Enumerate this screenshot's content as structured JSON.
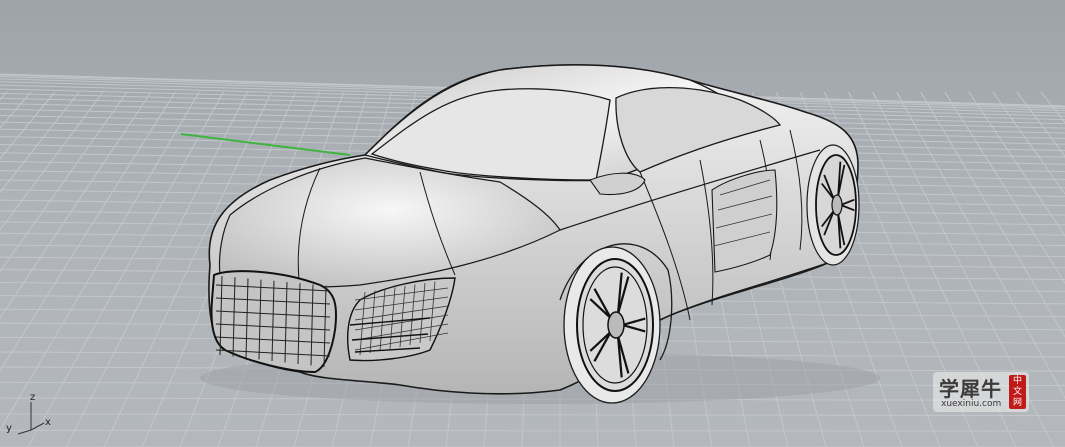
{
  "viewport": {
    "background_color": "#aab0b5",
    "grid_color": "#c4c8cc",
    "x_axis_color": "#3fb53f"
  },
  "axes": {
    "z_label": "z",
    "y_label": "y",
    "x_label": "x"
  },
  "watermark": {
    "main_text": "学犀牛",
    "sub_text": "xuexiniu.com",
    "badge_line1": "中",
    "badge_line2": "文",
    "badge_line3": "网",
    "badge_color": "#c01a1a"
  }
}
